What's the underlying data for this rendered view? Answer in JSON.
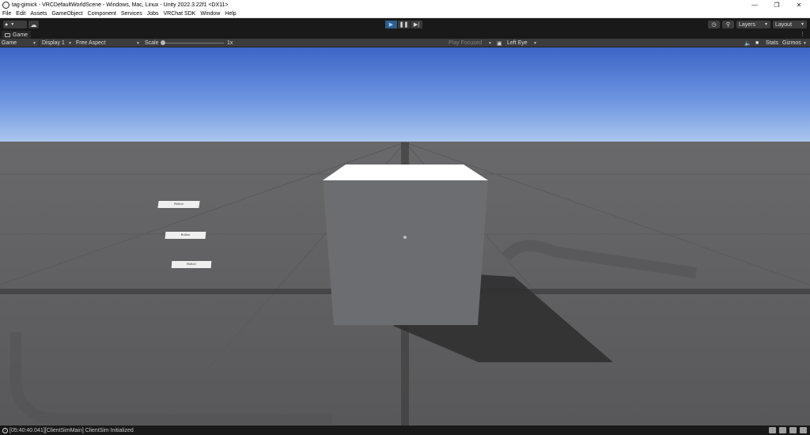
{
  "window": {
    "title": "tag-gimick - VRCDefaultWorldScene - Windows, Mac, Linux - Unity 2022.3.22f1 <DX11>",
    "controls": [
      "minimize",
      "maximize",
      "close"
    ]
  },
  "menu": {
    "items": [
      "File",
      "Edit",
      "Assets",
      "GameObject",
      "Component",
      "Services",
      "Jobs",
      "VRChat SDK",
      "Window",
      "Help"
    ]
  },
  "toolbar": {
    "account_icon": "account-icon",
    "cloud_icon": "cloud-icon",
    "play_icon": "play-icon",
    "pause_icon": "pause-icon",
    "step_icon": "step-icon",
    "history_icon": "history-icon",
    "search_icon": "search-icon",
    "layers_label": "Layers",
    "layout_label": "Layout"
  },
  "tab": {
    "label": "Game"
  },
  "game_toolbar": {
    "view_label": "Game",
    "display_label": "Display 1",
    "aspect_label": "Free Aspect",
    "scale_label": "Scale",
    "scale_value": "1x",
    "play_mode_label": "Play Focused",
    "eye_label": "Left Eye",
    "stats_label": "Stats",
    "gizmos_label": "Gizmos"
  },
  "scene": {
    "buttons": [
      "Button",
      "Button",
      "Button"
    ]
  },
  "status": {
    "message": "[05:40:40.041][ClientSimMain] ClientSim Initialized"
  },
  "colors": {
    "accent": "#2f5c8a",
    "sky_top": "#3c65c7",
    "sky_horizon": "#aac7ee",
    "ground": "#5e5e60"
  }
}
